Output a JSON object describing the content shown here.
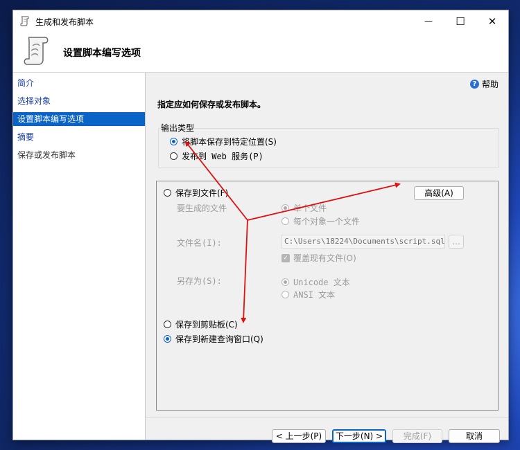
{
  "window": {
    "title": "生成和发布脚本",
    "controls": {
      "minimize": "—",
      "maximize": "☐",
      "close": "✕"
    }
  },
  "header": {
    "title": "设置脚本编写选项"
  },
  "sidebar": {
    "items": [
      {
        "label": "简介",
        "state": "link"
      },
      {
        "label": "选择对象",
        "state": "link"
      },
      {
        "label": "设置脚本编写选项",
        "state": "selected"
      },
      {
        "label": "摘要",
        "state": "link"
      },
      {
        "label": "保存或发布脚本",
        "state": "plain"
      }
    ]
  },
  "main": {
    "help_label": "帮助",
    "instruction": "指定应如何保存或发布脚本。",
    "output_type": {
      "label": "输出类型",
      "options": [
        {
          "label": "将脚本保存到特定位置(S)",
          "checked": true
        },
        {
          "label": "发布到 Web 服务(P)",
          "checked": false
        }
      ]
    },
    "save_options": {
      "save_to_file": "保存到文件(F)",
      "advanced_button": "高级(A)",
      "files_to_generate_label": "要生成的文件",
      "single_file": "单个文件",
      "one_per_object": "每个对象一个文件",
      "file_name_label": "文件名(I):",
      "file_name_value": "C:\\Users\\18224\\Documents\\script.sql",
      "browse_button": "...",
      "overwrite_label": "覆盖现有文件(O)",
      "save_as_label": "另存为(S):",
      "unicode_text": "Unicode 文本",
      "ansi_text": "ANSI 文本",
      "save_to_clipboard": "保存到剪贴板(C)",
      "save_to_query_window": "保存到新建查询窗口(Q)"
    },
    "buttons": {
      "previous": "< 上一步(P)",
      "next": "下一步(N) >",
      "finish": "完成(F)",
      "cancel": "取消"
    }
  },
  "colors": {
    "accent": "#0a64c8",
    "annotation_arrow": "#e01010"
  }
}
